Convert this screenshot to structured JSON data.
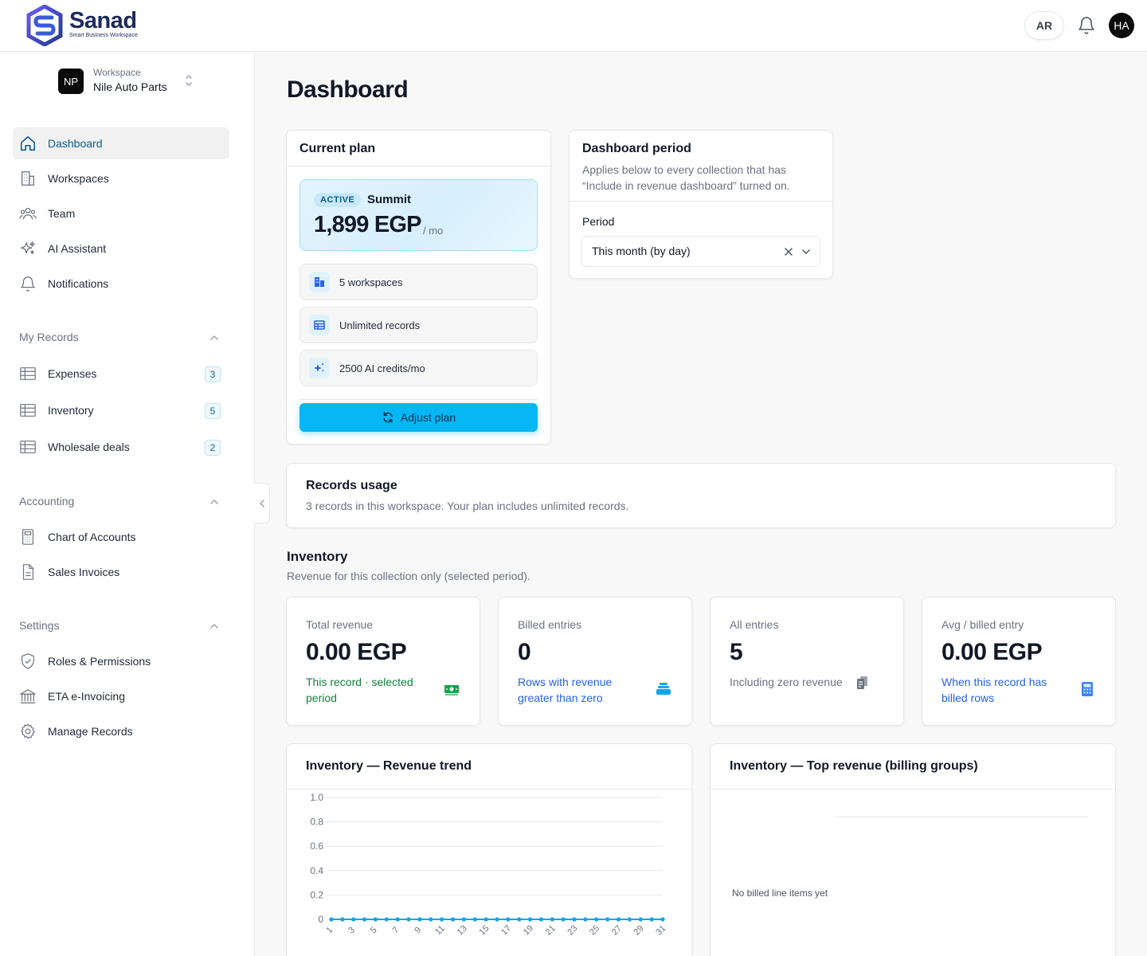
{
  "brand": {
    "name": "Sanad",
    "tagline": "Smart Business Workspace"
  },
  "header": {
    "lang_label": "AR",
    "avatar_initials": "HA"
  },
  "workspace": {
    "badge": "NP",
    "label": "Workspace",
    "name": "Nile Auto Parts"
  },
  "nav": {
    "main": [
      {
        "label": "Dashboard",
        "icon": "home-icon",
        "active": true
      },
      {
        "label": "Workspaces",
        "icon": "building-icon"
      },
      {
        "label": "Team",
        "icon": "users-icon"
      },
      {
        "label": "AI Assistant",
        "icon": "sparkles-icon"
      },
      {
        "label": "Notifications",
        "icon": "bell-icon"
      }
    ],
    "my_records": {
      "title": "My Records",
      "items": [
        {
          "label": "Expenses",
          "count": "3"
        },
        {
          "label": "Inventory",
          "count": "5"
        },
        {
          "label": "Wholesale deals",
          "count": "2"
        }
      ]
    },
    "accounting": {
      "title": "Accounting",
      "items": [
        {
          "label": "Chart of Accounts"
        },
        {
          "label": "Sales Invoices"
        }
      ]
    },
    "settings": {
      "title": "Settings",
      "items": [
        {
          "label": "Roles & Permissions"
        },
        {
          "label": "ETA e-Invoicing"
        },
        {
          "label": "Manage Records"
        }
      ]
    }
  },
  "page_title": "Dashboard",
  "plan": {
    "card_title": "Current plan",
    "status": "ACTIVE",
    "name": "Summit",
    "price": "1,899 EGP",
    "per": "/ mo",
    "features": [
      "5 workspaces",
      "Unlimited records",
      "2500 AI credits/mo"
    ],
    "adjust_label": "Adjust plan"
  },
  "period": {
    "card_title": "Dashboard period",
    "description": "Applies below to every collection that has “Include in revenue dashboard” turned on.",
    "field_label": "Period",
    "value": "This month (by day)"
  },
  "usage": {
    "title": "Records usage",
    "description": "3 records in this workspace. Your plan includes unlimited records."
  },
  "inventory": {
    "title": "Inventory",
    "description": "Revenue for this collection only (selected period).",
    "stats": [
      {
        "label": "Total revenue",
        "value": "0.00 EGP",
        "sub": "This record · selected period",
        "tone": "green",
        "icon": "money-icon"
      },
      {
        "label": "Billed entries",
        "value": "0",
        "sub": "Rows with revenue greater than zero",
        "tone": "blue",
        "icon": "stack-icon"
      },
      {
        "label": "All entries",
        "value": "5",
        "sub": "Including zero revenue",
        "tone": "grey",
        "icon": "copy-icon"
      },
      {
        "label": "Avg / billed entry",
        "value": "0.00 EGP",
        "sub": "When this record has billed rows",
        "tone": "blue",
        "icon": "calculator-icon"
      }
    ],
    "trend_title": "Inventory — Revenue trend",
    "top_title": "Inventory — Top revenue (billing groups)",
    "top_empty": "No billed line items yet"
  },
  "chart_data": {
    "type": "line",
    "title": "Inventory — Revenue trend",
    "x": [
      1,
      2,
      3,
      4,
      5,
      6,
      7,
      8,
      9,
      10,
      11,
      12,
      13,
      14,
      15,
      16,
      17,
      18,
      19,
      20,
      21,
      22,
      23,
      24,
      25,
      26,
      27,
      28,
      29,
      30,
      31
    ],
    "x_tick_labels": [
      "1",
      "3",
      "5",
      "7",
      "9",
      "11",
      "13",
      "15",
      "17",
      "19",
      "21",
      "23",
      "25",
      "27",
      "29",
      "31"
    ],
    "series": [
      {
        "values": [
          0,
          0,
          0,
          0,
          0,
          0,
          0,
          0,
          0,
          0,
          0,
          0,
          0,
          0,
          0,
          0,
          0,
          0,
          0,
          0,
          0,
          0,
          0,
          0,
          0,
          0,
          0,
          0,
          0,
          0,
          0
        ],
        "color": "#0ea5e9"
      }
    ],
    "y_ticks": [
      "0",
      "0.2",
      "0.4",
      "0.6",
      "0.8",
      "1.0"
    ],
    "ylim": [
      0,
      1
    ],
    "grid": true
  }
}
